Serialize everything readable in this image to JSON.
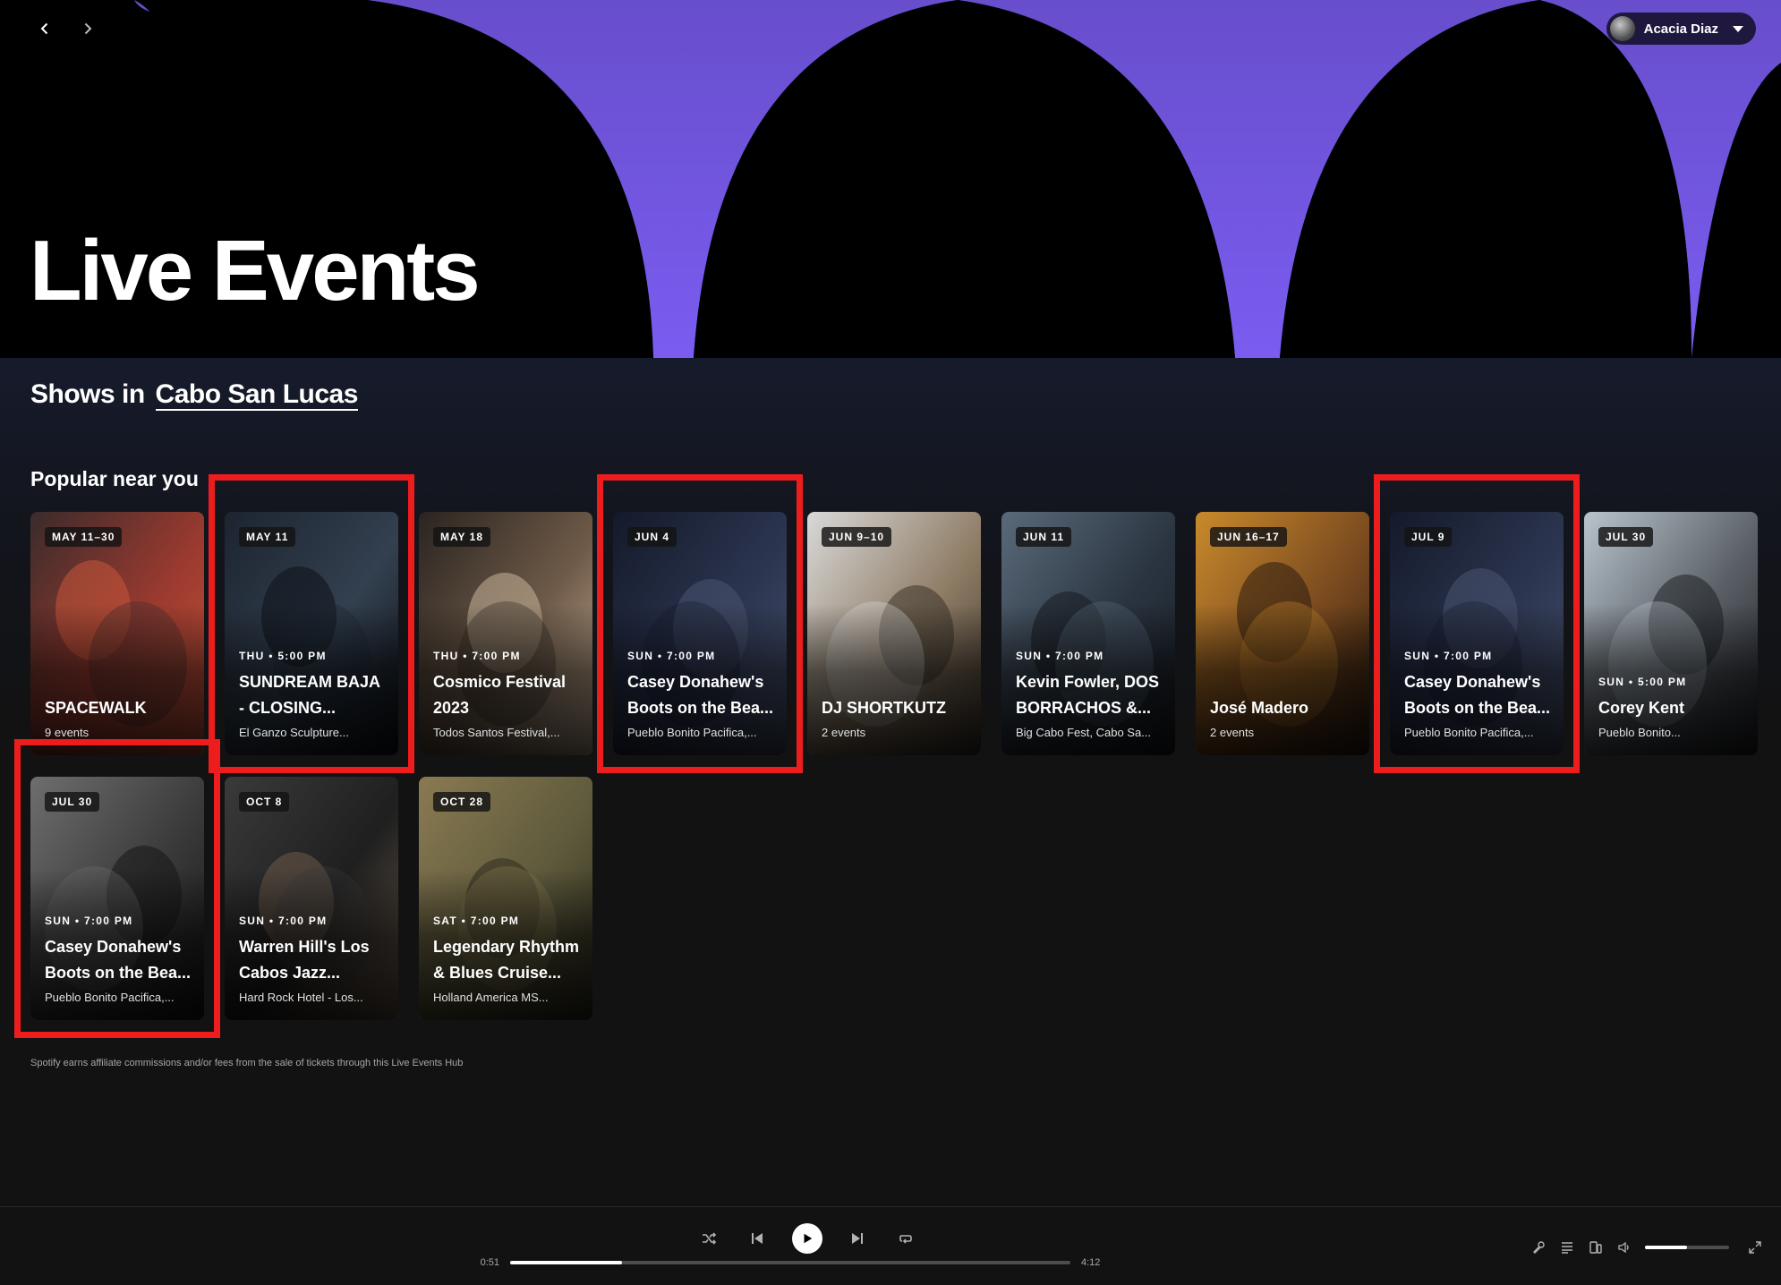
{
  "header": {
    "user_name": "Acacia Diaz",
    "page_title": "Live Events",
    "hero_colors": {
      "accent": "#7a5cf0",
      "background": "#000000"
    }
  },
  "shows": {
    "prefix": "Shows in",
    "city": "Cabo San Lucas"
  },
  "section": {
    "heading": "Popular near you"
  },
  "events": [
    {
      "date": "MAY 11–30",
      "time": "",
      "title": "SPACEWALK",
      "subtitle": "9 events",
      "highlighted": false,
      "palette": [
        "#3a2b2b",
        "#9b3a2f",
        "#c9563a"
      ]
    },
    {
      "date": "MAY 11",
      "time": "THU • 5:00 PM",
      "title": "SUNDREAM BAJA - CLOSING...",
      "subtitle": "El Ganzo Sculpture...",
      "highlighted": true,
      "palette": [
        "#1c2430",
        "#33404f",
        "#0d1117"
      ]
    },
    {
      "date": "MAY 18",
      "time": "THU • 7:00 PM",
      "title": "Cosmico Festival 2023",
      "subtitle": "Todos Santos Festival,...",
      "highlighted": false,
      "palette": [
        "#2a2420",
        "#6e5a48",
        "#c9b49a"
      ]
    },
    {
      "date": "JUN 4",
      "time": "SUN • 7:00 PM",
      "title": "Casey Donahew's Boots on the Bea...",
      "subtitle": "Pueblo Bonito Pacifica,...",
      "highlighted": true,
      "palette": [
        "#141a2a",
        "#2c3550",
        "#4a5470"
      ]
    },
    {
      "date": "JUN 9–10",
      "time": "",
      "title": "DJ SHORTKUTZ",
      "subtitle": "2 events",
      "highlighted": false,
      "palette": [
        "#d9d9d9",
        "#8f7d66",
        "#3b332a"
      ]
    },
    {
      "date": "JUN 11",
      "time": "SUN • 7:00 PM",
      "title": "Kevin Fowler, DOS BORRACHOS &...",
      "subtitle": "Big Cabo Fest, Cabo Sa...",
      "highlighted": false,
      "palette": [
        "#5a6a7a",
        "#2a3440",
        "#15191f"
      ]
    },
    {
      "date": "JUN 16–17",
      "time": "",
      "title": "José Madero",
      "subtitle": "2 events",
      "highlighted": false,
      "palette": [
        "#c98a2c",
        "#7a4a1f",
        "#2b1b10"
      ]
    },
    {
      "date": "JUL 9",
      "time": "SUN • 7:00 PM",
      "title": "Casey Donahew's Boots on the Bea...",
      "subtitle": "Pueblo Bonito Pacifica,...",
      "highlighted": true,
      "palette": [
        "#141a2a",
        "#2c3550",
        "#4a5470"
      ]
    },
    {
      "date": "JUL 30",
      "time": "SUN • 5:00 PM",
      "title": "Corey Kent",
      "subtitle": "Pueblo Bonito...",
      "highlighted": false,
      "palette": [
        "#b8c4cc",
        "#5a5f66",
        "#1e2024"
      ]
    },
    {
      "date": "JUL 30",
      "time": "SUN • 7:00 PM",
      "title": "Casey Donahew's Boots on the Bea...",
      "subtitle": "Pueblo Bonito Pacifica,...",
      "highlighted": true,
      "palette": [
        "#6e6e6e",
        "#3a3a3a",
        "#151515"
      ]
    },
    {
      "date": "OCT 8",
      "time": "SUN • 7:00 PM",
      "title": "Warren Hill's Los Cabos Jazz...",
      "subtitle": "Hard Rock Hotel - Los...",
      "highlighted": false,
      "palette": [
        "#3a3a3a",
        "#1f1f1f",
        "#6b5a4a"
      ]
    },
    {
      "date": "OCT 28",
      "time": "SAT • 7:00 PM",
      "title": "Legendary Rhythm & Blues Cruise...",
      "subtitle": "Holland America MS...",
      "highlighted": false,
      "palette": [
        "#8a7a52",
        "#5e5a3c",
        "#2e2c1e"
      ]
    }
  ],
  "disclaimer": "Spotify earns affiliate commissions and/or fees from the sale of tickets through this Live Events Hub",
  "player": {
    "elapsed": "0:51",
    "duration": "4:12",
    "progress_fraction": 0.2,
    "volume_fraction": 0.5
  }
}
